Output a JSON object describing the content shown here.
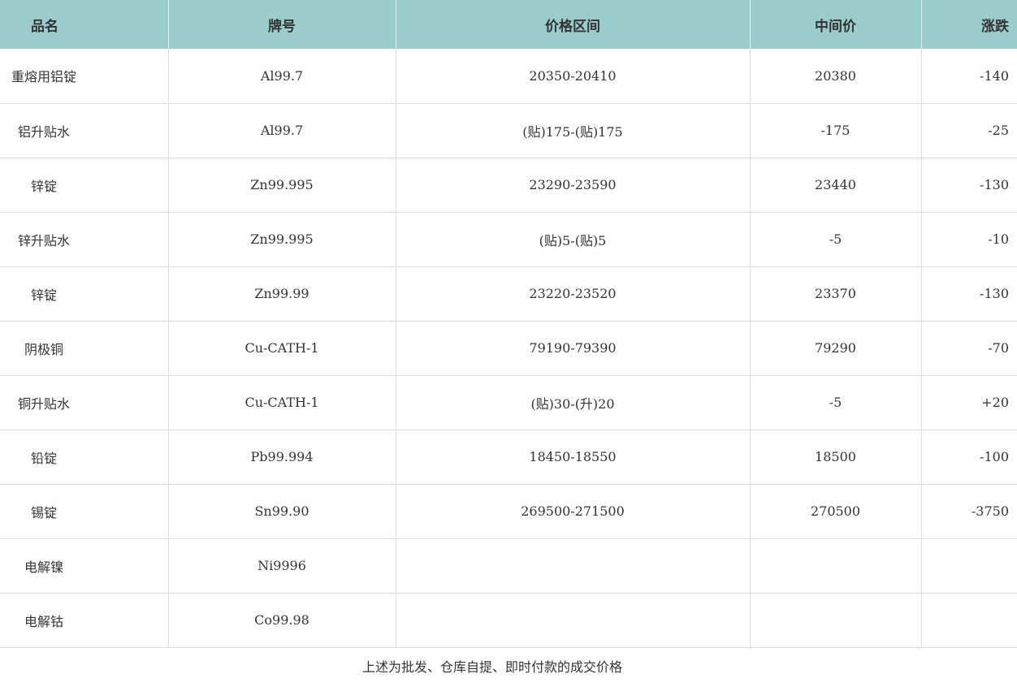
{
  "table": {
    "headers": {
      "name": "品名",
      "grade": "牌号",
      "price_range": "价格区间",
      "mid_price": "中间价",
      "change": "涨跌"
    },
    "rows": [
      {
        "name": "重熔用铝锭",
        "grade": "Al99.7",
        "price_range": "20350-20410",
        "mid_price": "20380",
        "change": "-140"
      },
      {
        "name": "铝升贴水",
        "grade": "Al99.7",
        "price_range": "(贴)175-(贴)175",
        "mid_price": "-175",
        "change": "-25"
      },
      {
        "name": "锌锭",
        "grade": "Zn99.995",
        "price_range": "23290-23590",
        "mid_price": "23440",
        "change": "-130"
      },
      {
        "name": "锌升贴水",
        "grade": "Zn99.995",
        "price_range": "(贴)5-(贴)5",
        "mid_price": "-5",
        "change": "-10"
      },
      {
        "name": "锌锭",
        "grade": "Zn99.99",
        "price_range": "23220-23520",
        "mid_price": "23370",
        "change": "-130"
      },
      {
        "name": "阴极铜",
        "grade": "Cu-CATH-1",
        "price_range": "79190-79390",
        "mid_price": "79290",
        "change": "-70"
      },
      {
        "name": "铜升贴水",
        "grade": "Cu-CATH-1",
        "price_range": "(贴)30-(升)20",
        "mid_price": "-5",
        "change": "+20"
      },
      {
        "name": "铅锭",
        "grade": "Pb99.994",
        "price_range": "18450-18550",
        "mid_price": "18500",
        "change": "-100"
      },
      {
        "name": "锡锭",
        "grade": "Sn99.90",
        "price_range": "269500-271500",
        "mid_price": "270500",
        "change": "-3750"
      },
      {
        "name": "电解镍",
        "grade": "Ni9996",
        "price_range": "",
        "mid_price": "",
        "change": ""
      },
      {
        "name": "电解钴",
        "grade": "Co99.98",
        "price_range": "",
        "mid_price": "",
        "change": ""
      }
    ]
  },
  "footer_note": "上述为批发、仓库自提、即时付款的成交价格",
  "colors": {
    "header_bg": "#9bcccc",
    "text": "#333333",
    "grid": "#dddddd"
  }
}
